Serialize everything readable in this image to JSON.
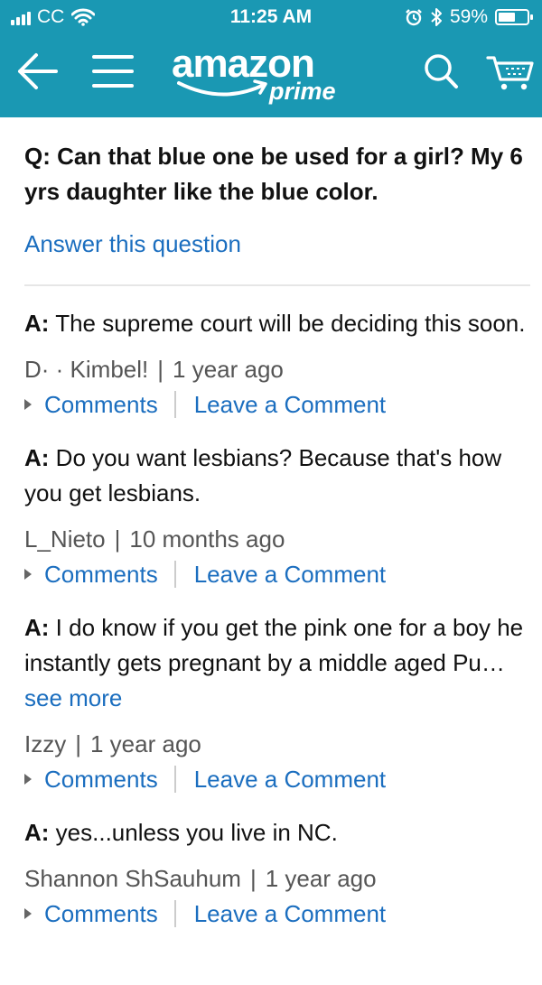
{
  "status_bar": {
    "carrier": "CC",
    "time": "11:25 AM",
    "battery_percent": "59%",
    "battery_level": 0.59,
    "icons": [
      "signal-icon",
      "wifi-icon",
      "alarm-icon",
      "bluetooth-icon",
      "battery-icon"
    ]
  },
  "header": {
    "brand": "amazon",
    "brand_sub": "prime",
    "background_color": "#1a98b3",
    "icons": [
      "back-arrow-icon",
      "hamburger-menu-icon",
      "search-icon",
      "cart-icon"
    ]
  },
  "question": {
    "label": "Q:",
    "text": "Can that blue one be used for a girl? My 6 yrs daughter like the blue color.",
    "answer_link": "Answer this question"
  },
  "answers": [
    {
      "label": "A:",
      "text": "The supreme court will be deciding this soon.",
      "author": "D· · Kimbel!",
      "time": "1 year ago",
      "comments": "Comments",
      "leave_comment": "Leave a Comment"
    },
    {
      "label": "A:",
      "text": "Do you want lesbians? Because that's how you get lesbians.",
      "author": "L_Nieto",
      "time": "10 months ago",
      "comments": "Comments",
      "leave_comment": "Leave a Comment"
    },
    {
      "label": "A:",
      "text": "I do know if you get the pink one for a boy he instantly gets pregnant by a middle aged Pu…",
      "see_more": "see more",
      "author": "Izzy",
      "time": "1 year ago",
      "comments": "Comments",
      "leave_comment": "Leave a Comment"
    },
    {
      "label": "A:",
      "text": "yes...unless you live in NC.",
      "author": "Shannon ShSauhum",
      "time": "1 year ago",
      "comments": "Comments",
      "leave_comment": "Leave a Comment"
    }
  ],
  "colors": {
    "link": "#1b6ebf",
    "text": "#111111",
    "meta": "#555555"
  }
}
